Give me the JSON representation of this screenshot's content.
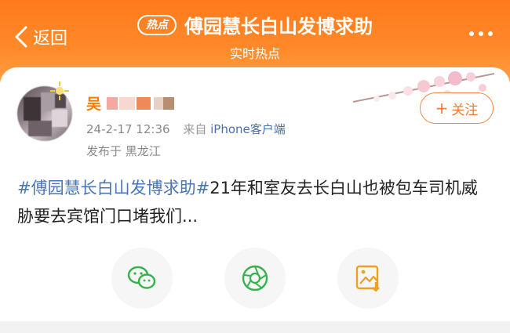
{
  "nav": {
    "back_label": "返回",
    "hot_badge": "热点",
    "title": "傅园慧长白山发博求助",
    "subtitle": "实时热点"
  },
  "post": {
    "username": "吴",
    "timestamp": "24-2-17 12:36",
    "source_prefix": "来自",
    "source_client": "iPhone客户端",
    "location": "发布于 黑龙江",
    "follow_label": "关注",
    "hashtag": "#傅园慧长白山发博求助#",
    "body": "21年和室友去长白山也被包车司机威胁要去宾馆门口堵我们..."
  },
  "share_buttons": [
    {
      "icon": "wechat-icon",
      "color": "#35b24a"
    },
    {
      "icon": "moments-icon",
      "color": "#35b24a"
    },
    {
      "icon": "save-image-icon",
      "color": "#f0a020"
    }
  ],
  "colors": {
    "header_orange": "#ff7a1c",
    "link_blue": "#4876b8",
    "username_orange": "#f57c00",
    "follow_orange": "#f07a30"
  }
}
